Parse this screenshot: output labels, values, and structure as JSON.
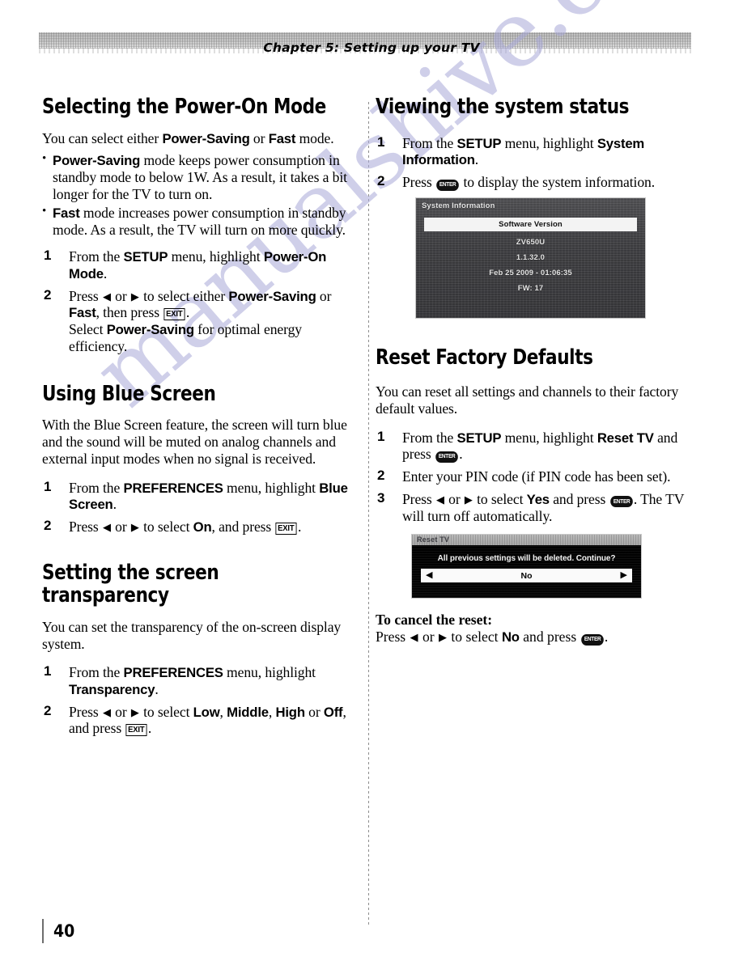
{
  "document": {
    "running_head": "Chapter 5: Setting up your TV",
    "page_number": "40",
    "watermark": "manualshive.com",
    "watermark_color": "#a9a9d8"
  },
  "left_column": {
    "section_power_on": {
      "heading": "Selecting the Power-On Mode",
      "intro_a": "You can select either ",
      "intro_b1": "Power-Saving",
      "intro_b2": " or ",
      "intro_b3": "Fast",
      "intro_b4": " mode.",
      "bullets": [
        {
          "bold": "Power-Saving",
          "text": " mode keeps power consumption in standby mode to below 1W. As a result, it takes a bit longer for the TV to turn on."
        },
        {
          "bold": "Fast",
          "text": " mode increases power consumption in standby mode. As a result, the TV will turn on more quickly."
        }
      ],
      "steps": [
        {
          "num": "1",
          "p1": "From the ",
          "b1": "SETUP",
          "p2": " menu, highlight ",
          "b2": "Power-On Mode",
          "p3": "."
        },
        {
          "num": "2",
          "p1": "Press ",
          "arrow_left": "◀",
          "p2": " or ",
          "arrow_right": "▶",
          "p3": " to select either ",
          "b1": "Power-Saving",
          "p4": " or ",
          "b2": "Fast",
          "p5": ", then press ",
          "key": "EXIT",
          "p6": ".",
          "sub1": "Select ",
          "sub_b": "Power-Saving",
          "sub2": " for optimal energy efficiency."
        }
      ]
    },
    "section_blue_screen": {
      "heading": "Using Blue Screen",
      "body": "With the Blue Screen feature, the screen will turn blue and the sound will be muted on analog channels and external input modes when no signal is received.",
      "steps": [
        {
          "num": "1",
          "p1": "From the ",
          "b1": "PREFERENCES",
          "p2": " menu, highlight ",
          "b2": "Blue Screen",
          "p3": "."
        },
        {
          "num": "2",
          "p1": "Press ",
          "arrow_left": "◀",
          "p2": " or ",
          "arrow_right": "▶",
          "p3": " to select ",
          "b1": "On",
          "p4": ", and press ",
          "key": "EXIT",
          "p5": "."
        }
      ]
    },
    "section_transparency": {
      "heading": "Setting the screen transparency",
      "body": "You can set the transparency of the on-screen display system.",
      "steps": [
        {
          "num": "1",
          "p1": "From the ",
          "b1": "PREFERENCES",
          "p2": " menu, highlight ",
          "b2": "Transparency",
          "p3": "."
        },
        {
          "num": "2",
          "p1": "Press ",
          "arrow_left": "◀",
          "p2": " or ",
          "arrow_right": "▶",
          "p3": " to select ",
          "b1": "Low",
          "p4": ", ",
          "b2": "Middle",
          "p5": ", ",
          "b3": "High",
          "p6": " or ",
          "b4": "Off",
          "p7": ", and press ",
          "key": "EXIT",
          "p8": "."
        }
      ]
    }
  },
  "right_column": {
    "section_system_status": {
      "heading": "Viewing the system status",
      "steps": [
        {
          "num": "1",
          "p1": "From the ",
          "b1": "SETUP",
          "p2": " menu, highlight ",
          "b2": "System Information",
          "p3": "."
        },
        {
          "num": "2",
          "p1": "Press ",
          "key": "ENTER",
          "p2": " to display the system information."
        }
      ],
      "screenshot": {
        "title": "System Information",
        "table_header": "Software Version",
        "lines": [
          "ZV650U",
          "1.1.32.0",
          "Feb 25 2009 - 01:06:35",
          "FW: 17"
        ]
      }
    },
    "section_reset": {
      "heading": "Reset Factory Defaults",
      "body": "You can reset all settings and channels to their factory default values.",
      "steps": [
        {
          "num": "1",
          "p1": "From the ",
          "b1": "SETUP",
          "p2": " menu, highlight ",
          "b2": "Reset TV",
          "p3": " and press ",
          "key": "ENTER",
          "p4": "."
        },
        {
          "num": "2",
          "p1": "Enter your PIN code (if PIN code has been set)."
        },
        {
          "num": "3",
          "p1": "Press ",
          "arrow_left": "◀",
          "p2": " or ",
          "arrow_right": "▶",
          "p3": " to select ",
          "b1": "Yes",
          "p4": " and press ",
          "key": "ENTER",
          "p5": ". The TV will turn off automatically."
        }
      ],
      "screenshot": {
        "title": "Reset TV",
        "message": "All previous settings will be deleted. Continue?",
        "arrow_left": "◀",
        "value": "No",
        "arrow_right": "▶"
      },
      "cancel": {
        "header": "To cancel the reset:",
        "p1": "Press ",
        "arrow_left": "◀",
        "p2": " or ",
        "arrow_right": "▶",
        "p3": " to select ",
        "b1": "No",
        "p4": " and press ",
        "key": "ENTER",
        "p5": "."
      }
    }
  }
}
